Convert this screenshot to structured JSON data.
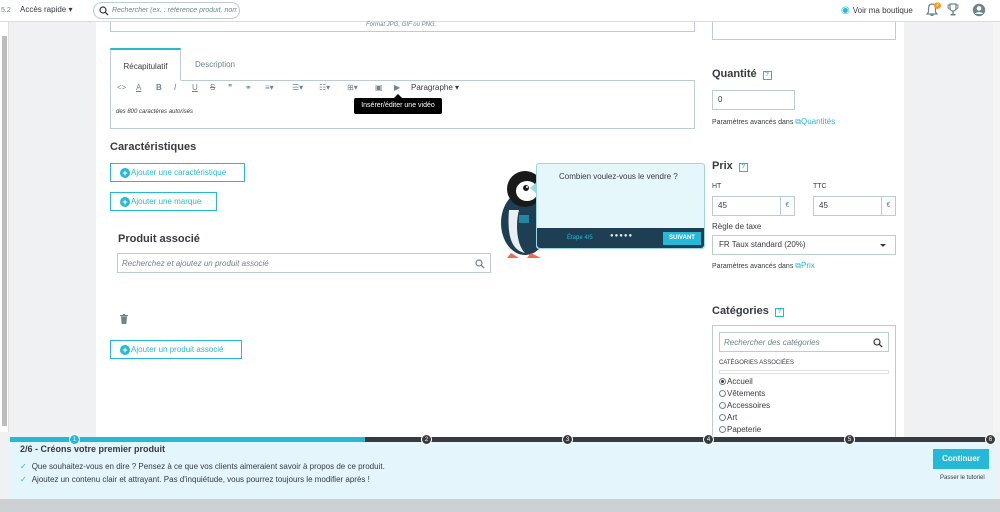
{
  "header": {
    "version": "5.2",
    "quick_access": "Accès rapide",
    "search_placeholder": "Rechercher (ex. : référence produit, nom",
    "shop_link": "Voir ma boutique",
    "notif_count": "2"
  },
  "images": {
    "format_hint": "Format JPG, GIF ou PNG."
  },
  "tabs": [
    {
      "label": "Récapitulatif"
    },
    {
      "label": "Description"
    }
  ],
  "editor": {
    "paragraph_label": "Paragraphe",
    "content": "des 800 caractères autorisés",
    "tooltip": "Insérer/éditer une vidéo"
  },
  "features": {
    "title": "Caractéristiques",
    "add_feature": "Ajouter une caractéristique",
    "add_brand": "Ajouter une marque"
  },
  "related": {
    "title": "Produit associé",
    "placeholder": "Recherchez et ajoutez un produit associé",
    "add_button": "Ajouter un produit associé"
  },
  "quantity": {
    "title": "Quantité",
    "value": "0",
    "advanced_text": "Paramètres avancés dans",
    "advanced_link": "Quantités"
  },
  "price": {
    "title": "Prix",
    "ht_label": "HT",
    "ht_value": "45",
    "ttc_label": "TTC",
    "ttc_value": "45",
    "currency": "€",
    "tax_label": "Règle de taxe",
    "tax_value": "FR Taux standard (20%)",
    "advanced_text": "Paramètres avancés dans",
    "advanced_link": "Prix"
  },
  "categories": {
    "title": "Catégories",
    "search_placeholder": "Rechercher des catégories",
    "associated_label": "Catégories associées",
    "items": [
      {
        "label": "Accueil",
        "selected": true
      },
      {
        "label": "Vêtements",
        "selected": false
      },
      {
        "label": "Accessoires",
        "selected": false
      },
      {
        "label": "Art",
        "selected": false
      },
      {
        "label": "Papeterie",
        "selected": false
      }
    ]
  },
  "popup": {
    "question": "Combien voulez-vous le vendre ?",
    "step": "Étape 4/5",
    "dots": "●●●●●",
    "next": "SUIVANT"
  },
  "tutorial": {
    "progress": 0.36,
    "steps": [
      "1",
      "2",
      "3",
      "4",
      "5",
      "6"
    ],
    "current_step": 1,
    "title": "2/6 - Créons votre premier produit",
    "line1": "Que souhaitez-vous en dire ? Pensez à ce que vos clients aimeraient savoir à propos de ce produit.",
    "line2": "Ajoutez un contenu clair et attrayant. Pas d'inquiétude, vous pourrez toujours le modifier après !",
    "continue": "Continuer",
    "skip": "Passer le tutoriel"
  },
  "colors": {
    "accent": "#25b9d7",
    "dark": "#363a41",
    "muted": "#6c868e"
  }
}
